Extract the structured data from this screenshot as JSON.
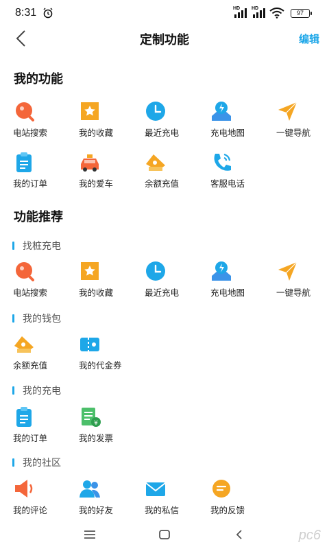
{
  "status": {
    "time": "8:31",
    "battery": "97",
    "signal_hd": "HD"
  },
  "header": {
    "title": "定制功能",
    "edit_label": "编辑"
  },
  "my_functions": {
    "title": "我的功能",
    "items": [
      {
        "label": "电站搜索",
        "icon": "search-station-icon"
      },
      {
        "label": "我的收藏",
        "icon": "favorite-icon"
      },
      {
        "label": "最近充电",
        "icon": "clock-icon"
      },
      {
        "label": "充电地图",
        "icon": "charging-map-icon"
      },
      {
        "label": "一键导航",
        "icon": "navigation-icon"
      },
      {
        "label": "我的订单",
        "icon": "order-icon"
      },
      {
        "label": "我的爱车",
        "icon": "car-icon"
      },
      {
        "label": "余额充值",
        "icon": "recharge-icon"
      },
      {
        "label": "客服电话",
        "icon": "phone-icon"
      }
    ]
  },
  "recommend": {
    "title": "功能推荐",
    "groups": [
      {
        "name": "找桩充电",
        "items": [
          {
            "label": "电站搜索",
            "icon": "search-station-icon"
          },
          {
            "label": "我的收藏",
            "icon": "favorite-icon"
          },
          {
            "label": "最近充电",
            "icon": "clock-icon"
          },
          {
            "label": "充电地图",
            "icon": "charging-map-icon"
          },
          {
            "label": "一键导航",
            "icon": "navigation-icon"
          }
        ]
      },
      {
        "name": "我的钱包",
        "items": [
          {
            "label": "余额充值",
            "icon": "recharge-icon"
          },
          {
            "label": "我的代金券",
            "icon": "voucher-icon"
          }
        ]
      },
      {
        "name": "我的充电",
        "items": [
          {
            "label": "我的订单",
            "icon": "order-icon"
          },
          {
            "label": "我的发票",
            "icon": "invoice-icon"
          }
        ]
      },
      {
        "name": "我的社区",
        "items": [
          {
            "label": "我的评论",
            "icon": "comment-icon"
          },
          {
            "label": "我的好友",
            "icon": "friends-icon"
          },
          {
            "label": "我的私信",
            "icon": "message-icon"
          },
          {
            "label": "我的反馈",
            "icon": "feedback-icon"
          }
        ]
      }
    ]
  },
  "colors": {
    "accent": "#1EA7E8",
    "orange": "#F5A623",
    "red_orange": "#F4663A"
  },
  "watermark": "pc6"
}
